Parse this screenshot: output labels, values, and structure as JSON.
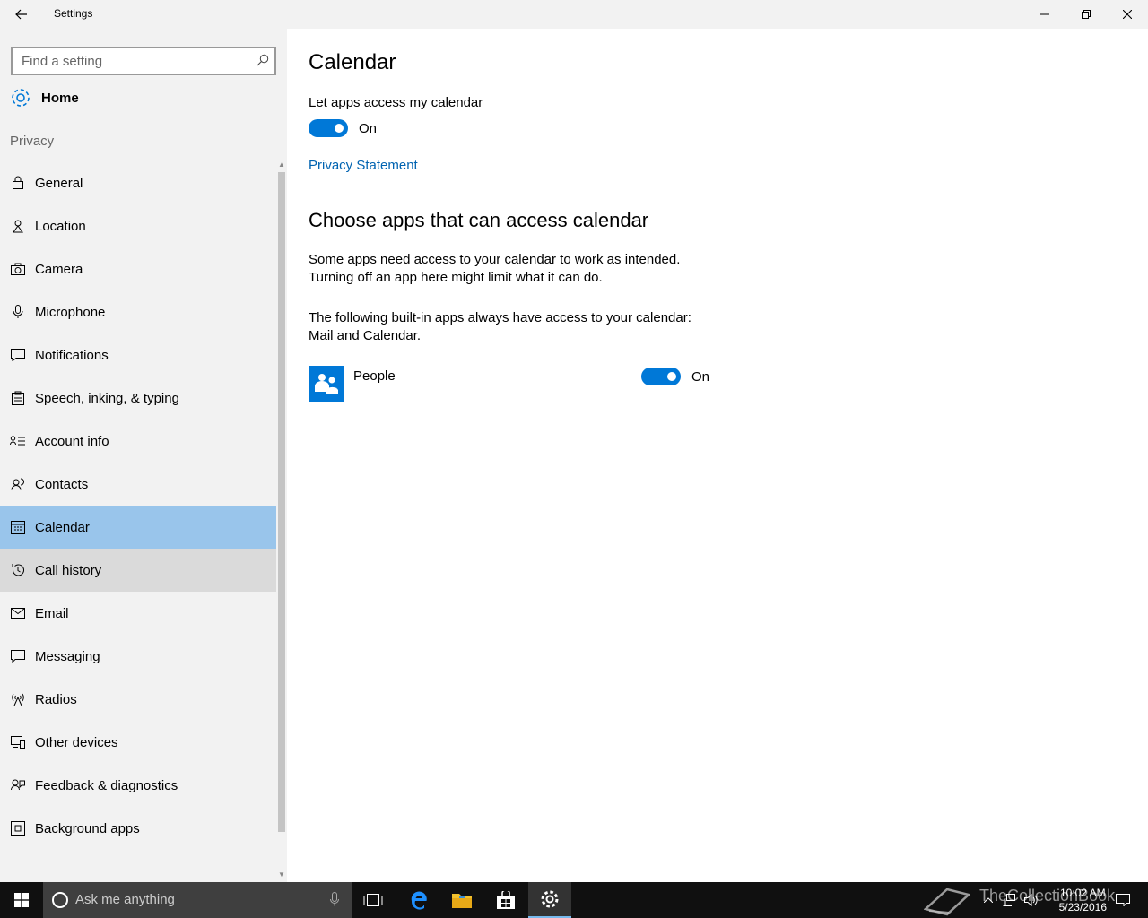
{
  "window": {
    "title": "Settings"
  },
  "sidebar": {
    "search_placeholder": "Find a setting",
    "home_label": "Home",
    "section_label": "Privacy",
    "items": [
      {
        "label": "General",
        "icon": "lock-icon"
      },
      {
        "label": "Location",
        "icon": "location-icon"
      },
      {
        "label": "Camera",
        "icon": "camera-icon"
      },
      {
        "label": "Microphone",
        "icon": "microphone-icon"
      },
      {
        "label": "Notifications",
        "icon": "notification-icon"
      },
      {
        "label": "Speech, inking, & typing",
        "icon": "clipboard-icon"
      },
      {
        "label": "Account info",
        "icon": "account-info-icon"
      },
      {
        "label": "Contacts",
        "icon": "contacts-icon"
      },
      {
        "label": "Calendar",
        "icon": "calendar-icon",
        "state": "selected"
      },
      {
        "label": "Call history",
        "icon": "history-icon",
        "state": "hover"
      },
      {
        "label": "Email",
        "icon": "mail-icon"
      },
      {
        "label": "Messaging",
        "icon": "message-icon"
      },
      {
        "label": "Radios",
        "icon": "radio-tower-icon"
      },
      {
        "label": "Other devices",
        "icon": "devices-icon"
      },
      {
        "label": "Feedback & diagnostics",
        "icon": "feedback-icon"
      },
      {
        "label": "Background apps",
        "icon": "background-apps-icon"
      }
    ]
  },
  "main": {
    "title": "Calendar",
    "access_label": "Let apps access my calendar",
    "access_toggle": {
      "state": "On"
    },
    "privacy_link": "Privacy Statement",
    "section_title": "Choose apps that can access calendar",
    "desc_line1": "Some apps need access to your calendar to work as intended.",
    "desc_line2": "Turning off an app here might limit what it can do.",
    "builtin_line1": "The following built-in apps always have access to your calendar:",
    "builtin_line2": "Mail and Calendar.",
    "apps": [
      {
        "name": "People",
        "toggle": "On",
        "icon": "people-icon"
      }
    ]
  },
  "taskbar": {
    "search_placeholder": "Ask me anything",
    "time": "10:02 AM",
    "date": "5/23/2016",
    "watermark": "TheCollectionBook"
  },
  "colors": {
    "accent": "#0078d7",
    "selected": "#99c5eb",
    "link": "#0063b1"
  }
}
